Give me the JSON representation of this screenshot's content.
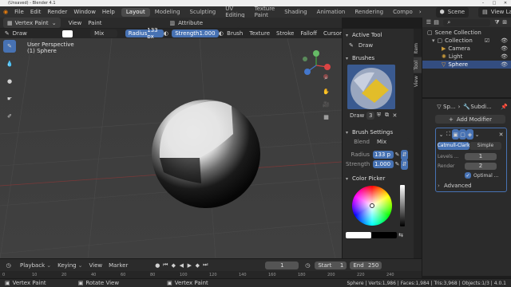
{
  "window": {
    "title": "(Unsaved) - Blender 4.1"
  },
  "menu": [
    "File",
    "Edit",
    "Render",
    "Window",
    "Help"
  ],
  "workspaces": [
    "Layout",
    "Modeling",
    "Sculpting",
    "UV Editing",
    "Texture Paint",
    "Shading",
    "Animation",
    "Rendering",
    "Compo"
  ],
  "active_workspace": "Layout",
  "scene": {
    "label": "Scene",
    "view_layer": "View Layer"
  },
  "header": {
    "mode": "Vertex Paint",
    "view": "View",
    "paint": "Paint",
    "attribute": "Attribute",
    "brush_name": "Draw",
    "blend": "Mix",
    "radius_label": "Radius",
    "radius_value": "133 px",
    "strength_label": "Strength",
    "strength_value": "1.000",
    "brush_menu": "Brush",
    "texture_menu": "Texture",
    "stroke_menu": "Stroke",
    "falloff_menu": "Falloff",
    "cursor_menu": "Cursor"
  },
  "viewport": {
    "line1": "User Perspective",
    "line2": "(1) Sphere"
  },
  "npanel": {
    "tabs": [
      "Item",
      "Tool",
      "View"
    ],
    "active_tool_title": "Active Tool",
    "active_tool": "Draw",
    "brushes_title": "Brushes",
    "brush_name": "Draw",
    "brush_users": "3",
    "brush_settings_title": "Brush Settings",
    "blend_label": "Blend",
    "blend_value": "Mix",
    "radius_label": "Radius",
    "radius_value": "133 p",
    "strength_label": "Strength",
    "strength_value": "1.000",
    "color_picker_title": "Color Picker"
  },
  "outliner": {
    "root": "Scene Collection",
    "items": [
      "Collection",
      "Camera",
      "Light",
      "Sphere"
    ]
  },
  "properties": {
    "object_name": "Sp...",
    "modifier_name": "Subdi...",
    "add_modifier": "Add Modifier",
    "algo_active": "Catmull-Clark",
    "algo_other": "Simple",
    "levels_label": "Levels ...",
    "levels_value": "1",
    "render_label": "Render",
    "render_value": "2",
    "optimal_label": "Optimal ...",
    "advanced": "Advanced"
  },
  "timeline": {
    "playback": "Playback",
    "keying": "Keying",
    "view": "View",
    "marker": "Marker",
    "current_frame": "1",
    "start_label": "Start",
    "start_value": "1",
    "end_label": "End",
    "end_value": "250",
    "ruler": [
      "0",
      "10",
      "20",
      "40",
      "60",
      "80",
      "100",
      "120",
      "140",
      "160",
      "180",
      "200",
      "220",
      "240"
    ]
  },
  "status": {
    "left": "Vertex Paint",
    "middle": "Rotate View",
    "right": "Vertex Paint",
    "stats": "Sphere | Verts:1,986 | Faces:1,984 | Tris:3,968 | Objects:1/3 | 4.0.1"
  },
  "colors": {
    "accent": "#4772b3",
    "header": "#303030",
    "viewport": "#3f3f3f"
  }
}
